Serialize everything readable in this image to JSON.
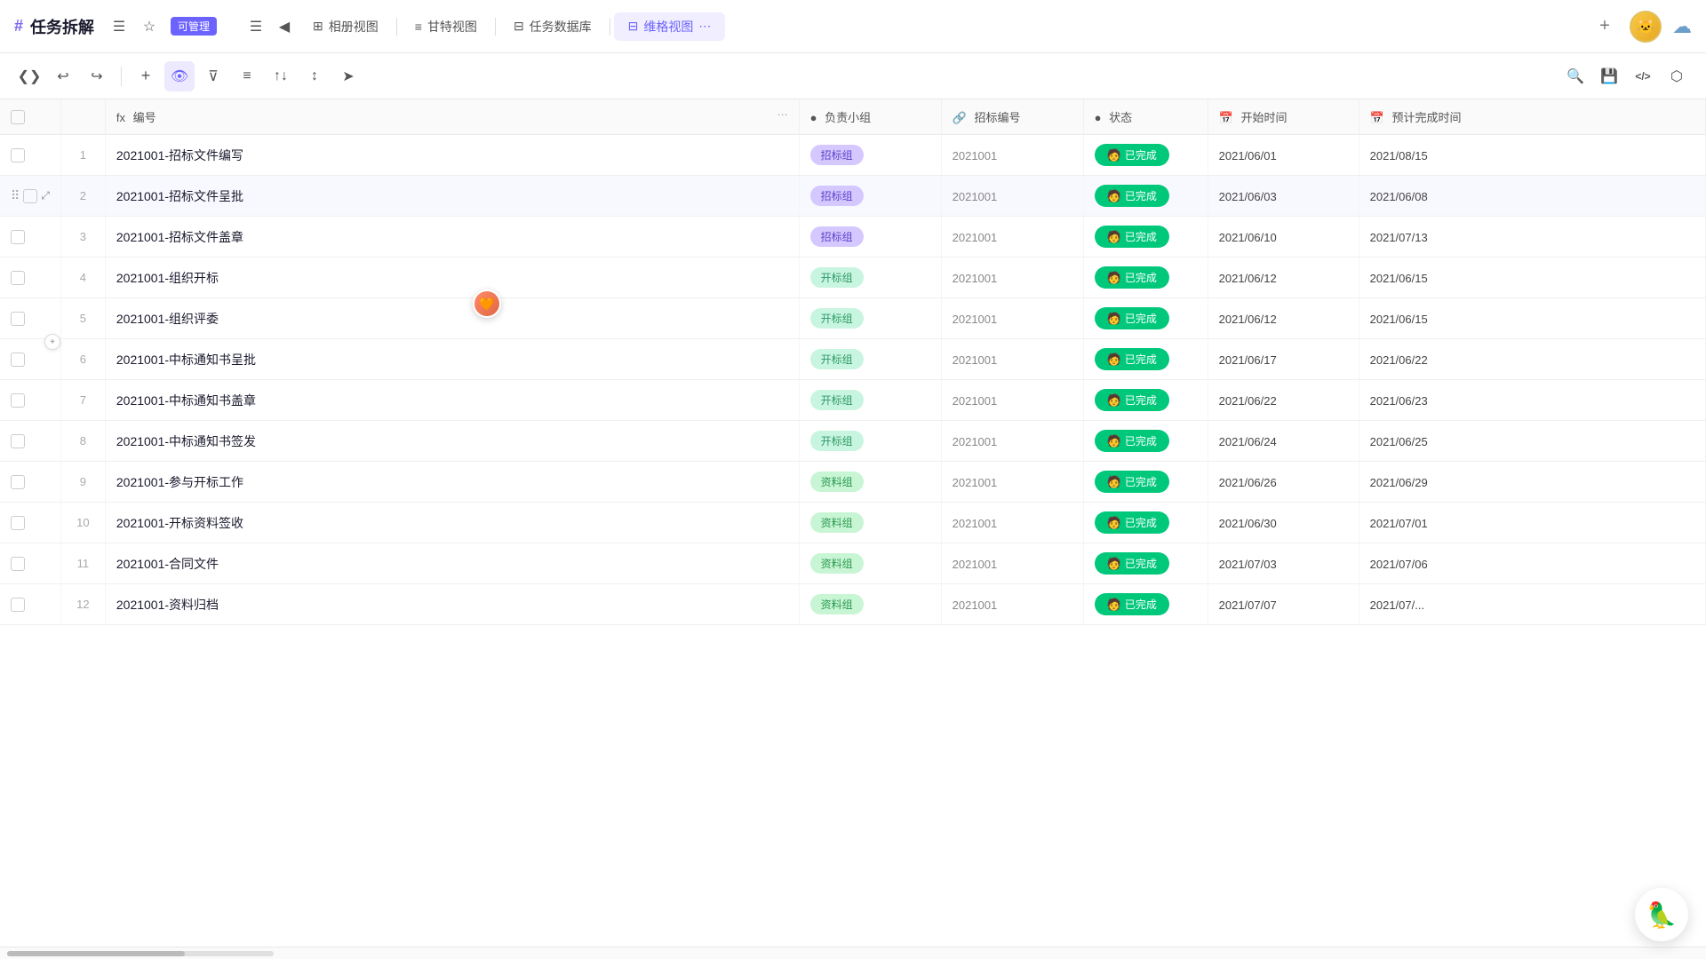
{
  "header": {
    "hashtag": "#",
    "title": "任务拆解",
    "badge": "可管理",
    "icons": [
      "bookmark-icon",
      "star-icon"
    ],
    "tabs": [
      {
        "label": "相册视图",
        "icon": "grid",
        "active": false
      },
      {
        "label": "甘特视图",
        "icon": "gantt",
        "active": false
      },
      {
        "label": "任务数据库",
        "icon": "table",
        "active": false
      },
      {
        "label": "维格视图",
        "icon": "table-active",
        "active": true
      }
    ],
    "more_icon": "⋯",
    "plus_icon": "+",
    "avatar_emoji": "🐱",
    "cloud_emoji": "☁️"
  },
  "toolbar": {
    "buttons": [
      {
        "name": "expand-btn",
        "icon": "❯❮",
        "active": false
      },
      {
        "name": "undo-btn",
        "icon": "↩",
        "active": false
      },
      {
        "name": "redo-btn",
        "icon": "↪",
        "active": false
      },
      {
        "name": "add-btn",
        "icon": "+",
        "active": false
      },
      {
        "name": "view-btn",
        "icon": "👁",
        "active": true
      },
      {
        "name": "filter-btn",
        "icon": "⊽",
        "active": false
      },
      {
        "name": "group-btn",
        "icon": "≡",
        "active": false
      },
      {
        "name": "sort-asc-btn",
        "icon": "↑↓",
        "active": false
      },
      {
        "name": "sort-desc-btn",
        "icon": "↕",
        "active": false
      },
      {
        "name": "send-btn",
        "icon": "➤",
        "active": false
      }
    ],
    "right_buttons": [
      {
        "name": "search-btn",
        "icon": "🔍"
      },
      {
        "name": "save-btn",
        "icon": "💾"
      },
      {
        "name": "code-btn",
        "icon": "</>"
      },
      {
        "name": "cube-btn",
        "icon": "⬡"
      }
    ]
  },
  "table": {
    "columns": [
      {
        "key": "check",
        "label": ""
      },
      {
        "key": "num",
        "label": ""
      },
      {
        "key": "name",
        "label": "编号",
        "prefix": "fx"
      },
      {
        "key": "group",
        "label": "负责小组",
        "prefix": "●"
      },
      {
        "key": "bid_num",
        "label": "招标编号",
        "prefix": "🔗"
      },
      {
        "key": "status",
        "label": "状态",
        "prefix": "●"
      },
      {
        "key": "start",
        "label": "开始时间",
        "prefix": "📅"
      },
      {
        "key": "end",
        "label": "预计完成时间",
        "prefix": "📅"
      }
    ],
    "rows": [
      {
        "num": 1,
        "name": "2021001-招标文件编写",
        "group": "招标组",
        "group_type": "bid",
        "bid_num": "2021001",
        "status": "已完成",
        "start": "2021/06/01",
        "end": "2021/08/15"
      },
      {
        "num": 2,
        "name": "2021001-招标文件呈批",
        "group": "招标组",
        "group_type": "bid",
        "bid_num": "2021001",
        "status": "已完成",
        "start": "2021/06/03",
        "end": "2021/06/08"
      },
      {
        "num": 3,
        "name": "2021001-招标文件盖章",
        "group": "招标组",
        "group_type": "bid",
        "bid_num": "2021001",
        "status": "已完成",
        "start": "2021/06/10",
        "end": "2021/07/13"
      },
      {
        "num": 4,
        "name": "2021001-组织开标",
        "group": "开标组",
        "group_type": "open",
        "bid_num": "2021001",
        "status": "已完成",
        "start": "2021/06/12",
        "end": "2021/06/15"
      },
      {
        "num": 5,
        "name": "2021001-组织评委",
        "group": "开标组",
        "group_type": "open",
        "bid_num": "2021001",
        "status": "已完成",
        "start": "2021/06/12",
        "end": "2021/06/15"
      },
      {
        "num": 6,
        "name": "2021001-中标通知书呈批",
        "group": "开标组",
        "group_type": "open",
        "bid_num": "2021001",
        "status": "已完成",
        "start": "2021/06/17",
        "end": "2021/06/22"
      },
      {
        "num": 7,
        "name": "2021001-中标通知书盖章",
        "group": "开标组",
        "group_type": "open",
        "bid_num": "2021001",
        "status": "已完成",
        "start": "2021/06/22",
        "end": "2021/06/23"
      },
      {
        "num": 8,
        "name": "2021001-中标通知书签发",
        "group": "开标组",
        "group_type": "open",
        "bid_num": "2021001",
        "status": "已完成",
        "start": "2021/06/24",
        "end": "2021/06/25"
      },
      {
        "num": 9,
        "name": "2021001-参与开标工作",
        "group": "资料组",
        "group_type": "data",
        "bid_num": "2021001",
        "status": "已完成",
        "start": "2021/06/26",
        "end": "2021/06/29"
      },
      {
        "num": 10,
        "name": "2021001-开标资料签收",
        "group": "资料组",
        "group_type": "data",
        "bid_num": "2021001",
        "status": "已完成",
        "start": "2021/06/30",
        "end": "2021/07/01"
      },
      {
        "num": 11,
        "name": "2021001-合同文件",
        "group": "资料组",
        "group_type": "data",
        "bid_num": "2021001",
        "status": "已完成",
        "start": "2021/07/03",
        "end": "2021/07/06"
      },
      {
        "num": 12,
        "name": "2021001-资料归档",
        "group": "资料组",
        "group_type": "data",
        "bid_num": "2021001",
        "status": "已完成",
        "start": "2021/07/07",
        "end": "2021/07/..."
      }
    ],
    "status_emoji": "🧑"
  },
  "chatbot": {
    "emoji": "🦜"
  }
}
